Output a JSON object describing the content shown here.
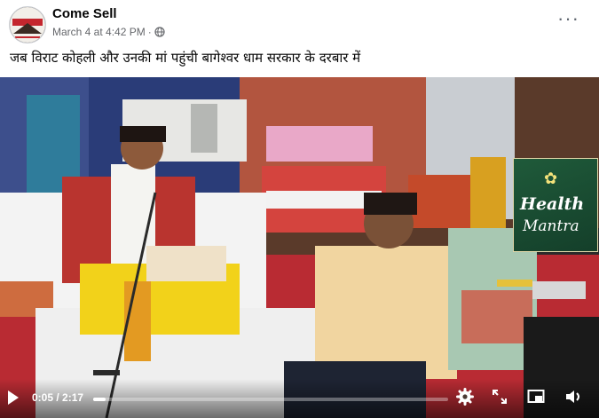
{
  "post": {
    "page_name": "Come Sell",
    "avatar_text": "COMESELL",
    "timestamp": "March 4 at 4:42 PM",
    "separator": "·",
    "caption": "जब विराट कोहली और उनकी मां पहुंची बागेश्वर धाम सरकार के दरबार में"
  },
  "video": {
    "overlay_badge_line1": "Health",
    "overlay_badge_line2": "Mantra",
    "current_time": "0:05",
    "duration": "2:17",
    "progress_fraction": 0.036
  },
  "icons": [
    "globe-icon",
    "more-options-icon",
    "play-icon",
    "settings-gear-icon",
    "fullscreen-icon",
    "picture-in-picture-icon",
    "volume-icon"
  ]
}
